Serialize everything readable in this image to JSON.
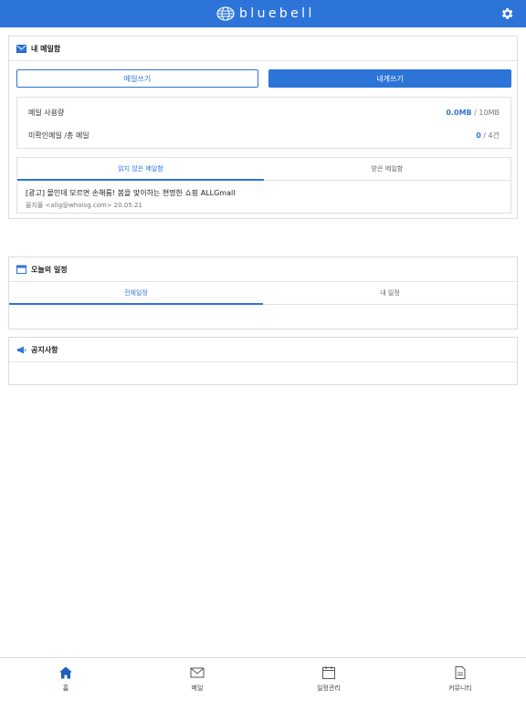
{
  "header": {
    "brand": "bluebell",
    "settings_icon": "gear-icon"
  },
  "mailbox": {
    "title": "내 메일함",
    "write_label": "메일쓰기",
    "self_write_label": "내게쓰기",
    "usage_label": "메일 사용량",
    "usage_used": "0.0MB",
    "usage_total": " / 10MB",
    "unread_label": "미확인메일 /총 메일",
    "unread_count": "0",
    "total_count": " / 4건",
    "tabs": [
      {
        "label": "읽지 않은 메일함",
        "active": true
      },
      {
        "label": "받은 메일함",
        "active": false
      }
    ],
    "item": {
      "subject": "[광고] 몰인데 모르면 손해룸! 봄을 맞이하는 현명한 쇼핑 ALLGmall",
      "meta": "올지몰 <allg@whoisg.com> 20.05.21"
    }
  },
  "schedule": {
    "title": "오늘의 일정",
    "tabs": [
      {
        "label": "전체일정",
        "active": true
      },
      {
        "label": "내 일정",
        "active": false
      }
    ]
  },
  "notice": {
    "title": "공지사항"
  },
  "bottom_nav": [
    {
      "label": "홈",
      "icon": "home-icon",
      "active": true
    },
    {
      "label": "메일",
      "icon": "mail-icon",
      "active": false
    },
    {
      "label": "일정관리",
      "icon": "calendar-icon",
      "active": false
    },
    {
      "label": "커뮤니티",
      "icon": "document-icon",
      "active": false
    }
  ],
  "colors": {
    "primary": "#2d74d8",
    "border": "#dcdcdc"
  }
}
